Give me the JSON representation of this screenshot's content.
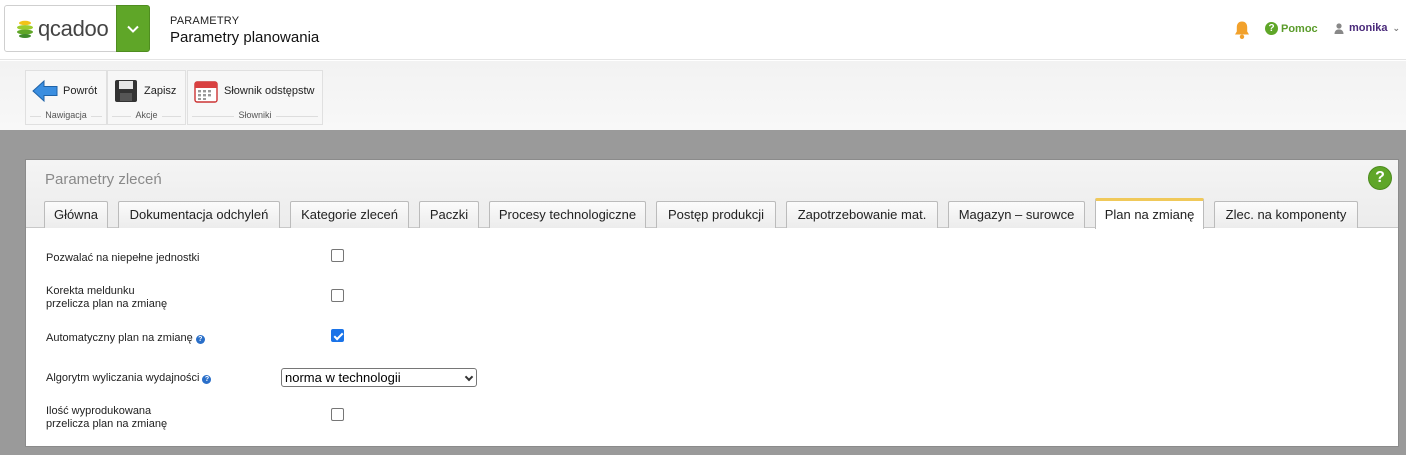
{
  "app": {
    "logo_text": "qcadoo"
  },
  "header": {
    "breadcrumb_section": "PARAMETRY",
    "page_title": "Parametry planowania",
    "help_label": "Pomoc",
    "user_name": "monika"
  },
  "ribbon": {
    "groups": [
      {
        "label": "Nawigacja",
        "button": "Powrót"
      },
      {
        "label": "Akcje",
        "button": "Zapisz"
      },
      {
        "label": "Słowniki",
        "button": "Słownik odstępstw"
      }
    ]
  },
  "panel": {
    "title": "Parametry zleceń",
    "tabs": [
      {
        "label": "Główna",
        "active": false
      },
      {
        "label": "Dokumentacja odchyleń",
        "active": false
      },
      {
        "label": "Kategorie zleceń",
        "active": false
      },
      {
        "label": "Paczki",
        "active": false
      },
      {
        "label": "Procesy technologiczne",
        "active": false
      },
      {
        "label": "Postęp produkcji",
        "active": false
      },
      {
        "label": "Zapotrzebowanie mat.",
        "active": false
      },
      {
        "label": "Magazyn – surowce",
        "active": false
      },
      {
        "label": "Plan na zmianę",
        "active": true
      },
      {
        "label": "Zlec. na komponenty",
        "active": false
      }
    ]
  },
  "form": {
    "f1": {
      "label": "Pozwalać na niepełne jednostki",
      "checked": false
    },
    "f2": {
      "label_line1": "Korekta meldunku",
      "label_line2": "przelicza plan na zmianę",
      "checked": false
    },
    "f3": {
      "label": "Automatyczny plan na zmianę",
      "checked": true
    },
    "f4": {
      "label": "Algorytm wyliczania wydajności",
      "value": "norma w technologii"
    },
    "f5": {
      "label_line1": "Ilość wyprodukowana",
      "label_line2": "przelicza plan na zmianę",
      "checked": false
    }
  },
  "colors": {
    "brand_green": "#5fa628",
    "active_tab_accent": "#f0c95a",
    "workspace_gray": "#9a9a9a",
    "user_purple": "#4a2a7a"
  },
  "icons": [
    "logo-icon",
    "chevron-down-icon",
    "bell-icon",
    "help-icon",
    "user-icon",
    "back-arrow-icon",
    "save-icon",
    "calendar-icon",
    "info-icon"
  ]
}
